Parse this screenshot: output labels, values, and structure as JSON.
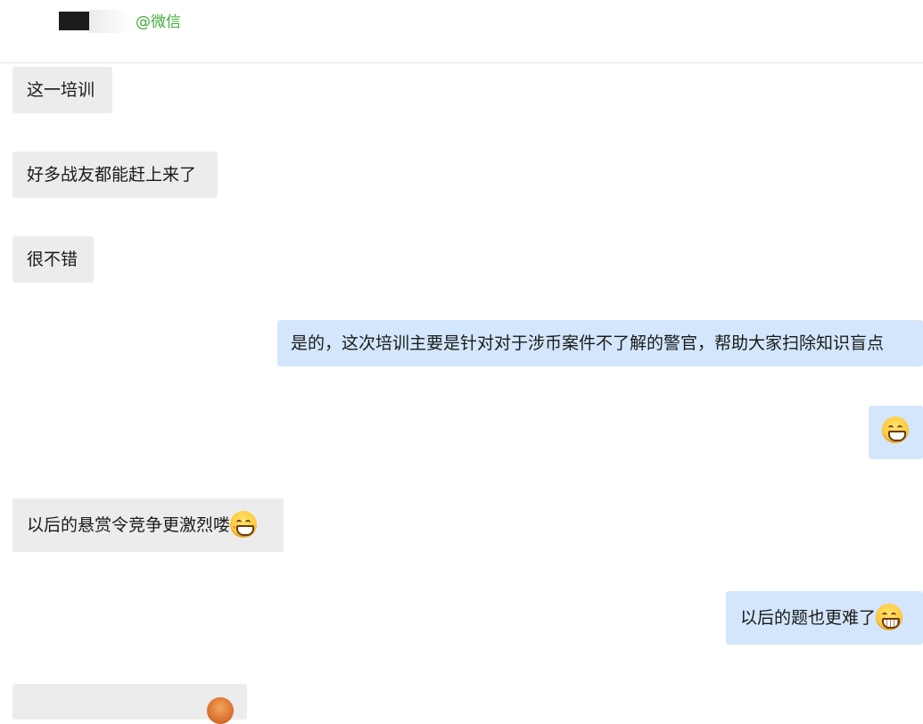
{
  "header": {
    "source_tag": "@微信"
  },
  "messages": [
    {
      "side": "in",
      "text": "这一培训"
    },
    {
      "side": "in",
      "text": "好多战友都能赶上来了"
    },
    {
      "side": "in",
      "text": "很不错"
    },
    {
      "side": "out",
      "text": "是的，这次培训主要是针对对于涉币案件不了解的警官，帮助大家扫除知识盲点"
    },
    {
      "side": "out",
      "text": "",
      "emoji": "grinning-face-emoji"
    },
    {
      "side": "in",
      "text": "以后的悬赏令竞争更激烈喽",
      "emoji": "grinning-blush-emoji"
    },
    {
      "side": "out",
      "text": "以后的题也更难了",
      "emoji": "grimacing-face-emoji"
    },
    {
      "side": "in",
      "text": "",
      "emoji": "partial-emoji"
    }
  ],
  "colors": {
    "incoming_bubble": "#ececec",
    "outgoing_bubble": "#d3e6fb",
    "source_tag": "#3fae3a"
  }
}
